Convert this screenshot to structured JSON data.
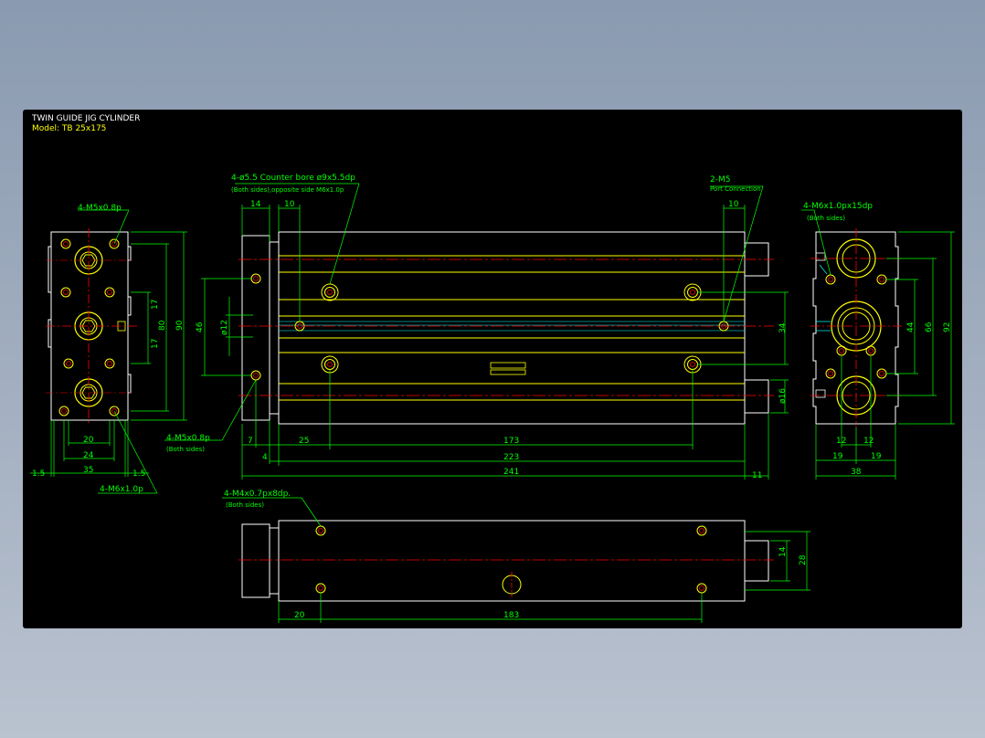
{
  "title": {
    "name": "TWIN GUIDE JIG CYLINDER",
    "model": "Model: TB 25x175"
  },
  "colors": {
    "background": "#000000",
    "outline": "#ffffff",
    "body": "#ffff00",
    "dimension": "#00ff00",
    "centerline": "#ff0000",
    "hatch": "#00ffff"
  },
  "left_view": {
    "callout_top": "4-M5x0.8p",
    "callout_bottom": "4-M6x1.0p",
    "dims": {
      "d17a": "17",
      "d17b": "17",
      "d80": "80",
      "d90": "90",
      "d20": "20",
      "d24": "24",
      "d35": "35",
      "d15a": "1.5",
      "d15b": "1.5"
    }
  },
  "front_view": {
    "callout_counterbore_1": "4-ø5.5 Counter bore ø9x5.5dp",
    "callout_counterbore_2": "(Both sides),opposite side M6x1.0p",
    "callout_port_1": "2-M5",
    "callout_port_2": "Port Connection",
    "callout_m5_1": "4-M5x0.8p",
    "callout_m5_2": "(Both sides)",
    "dims": {
      "d14": "14",
      "d10a": "10",
      "d10b": "10",
      "d46": "46",
      "d12": "ø12",
      "d34": "34",
      "d16": "ø16",
      "d7": "7",
      "d4": "4",
      "d25": "25",
      "d173": "173",
      "d223": "223",
      "d241": "241",
      "d11": "11"
    }
  },
  "right_view": {
    "callout_1": "4-M6x1.0px15dp",
    "callout_2": "(Both sides)",
    "dims": {
      "d44": "44",
      "d66": "66",
      "d92": "92",
      "d12a": "12",
      "d12b": "12",
      "d19a": "19",
      "d19b": "19",
      "d38": "38"
    }
  },
  "bottom_view": {
    "callout_1": "4-M4x0.7px8dp.",
    "callout_2": "(Both sides)",
    "dims": {
      "d14": "14",
      "d28": "28",
      "d20": "20",
      "d183": "183"
    }
  }
}
